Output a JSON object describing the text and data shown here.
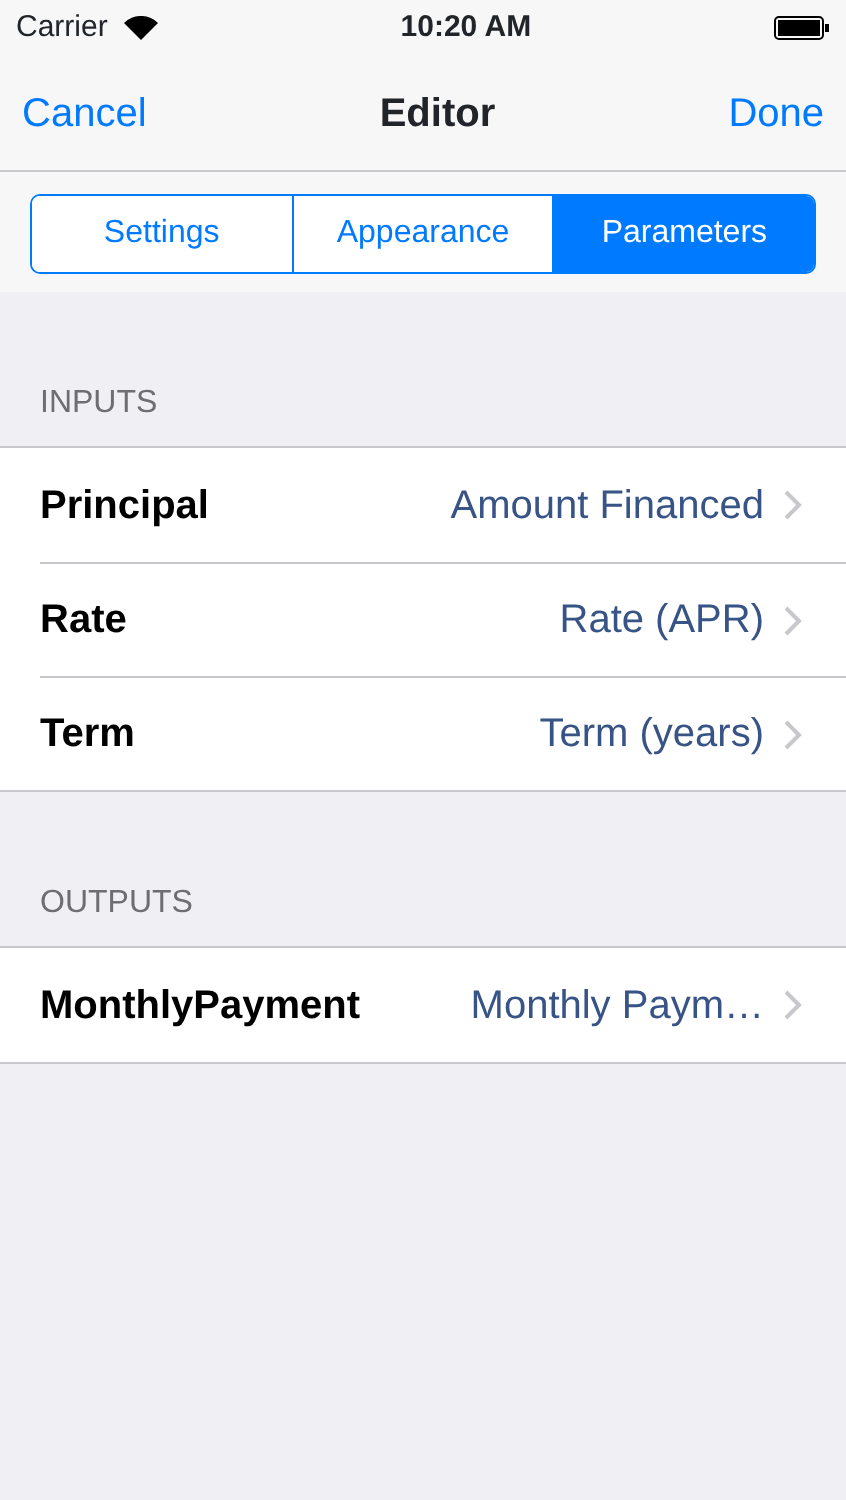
{
  "status_bar": {
    "carrier": "Carrier",
    "time": "10:20 AM"
  },
  "nav": {
    "cancel": "Cancel",
    "title": "Editor",
    "done": "Done"
  },
  "segments": [
    {
      "label": "Settings",
      "selected": false
    },
    {
      "label": "Appearance",
      "selected": false
    },
    {
      "label": "Parameters",
      "selected": true
    }
  ],
  "sections": [
    {
      "header": "INPUTS",
      "rows": [
        {
          "label": "Principal",
          "value": "Amount Financed"
        },
        {
          "label": "Rate",
          "value": "Rate (APR)"
        },
        {
          "label": "Term",
          "value": "Term (years)"
        }
      ]
    },
    {
      "header": "OUTPUTS",
      "rows": [
        {
          "label": "MonthlyPayment",
          "value": "Monthly Paym…"
        }
      ]
    }
  ]
}
